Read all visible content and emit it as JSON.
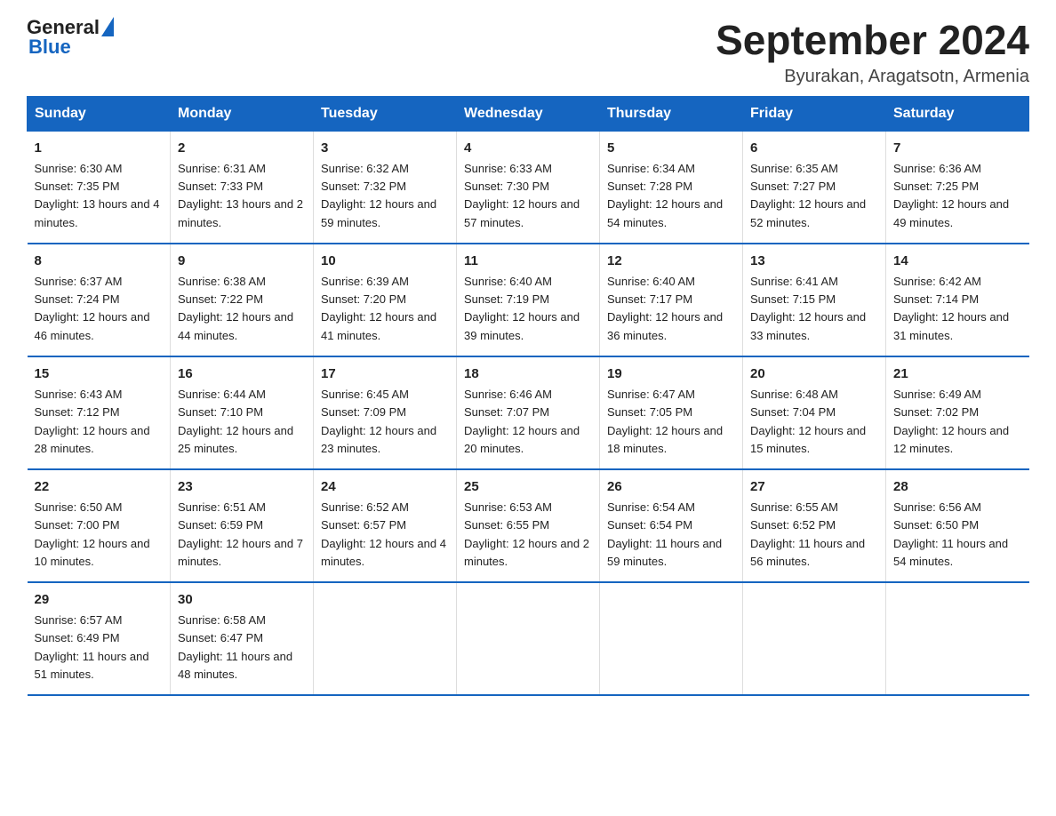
{
  "logo": {
    "text_general": "General",
    "text_blue": "Blue"
  },
  "calendar": {
    "title": "September 2024",
    "subtitle": "Byurakan, Aragatsotn, Armenia"
  },
  "days_of_week": [
    "Sunday",
    "Monday",
    "Tuesday",
    "Wednesday",
    "Thursday",
    "Friday",
    "Saturday"
  ],
  "weeks": [
    [
      {
        "day": "1",
        "sunrise": "Sunrise: 6:30 AM",
        "sunset": "Sunset: 7:35 PM",
        "daylight": "Daylight: 13 hours and 4 minutes."
      },
      {
        "day": "2",
        "sunrise": "Sunrise: 6:31 AM",
        "sunset": "Sunset: 7:33 PM",
        "daylight": "Daylight: 13 hours and 2 minutes."
      },
      {
        "day": "3",
        "sunrise": "Sunrise: 6:32 AM",
        "sunset": "Sunset: 7:32 PM",
        "daylight": "Daylight: 12 hours and 59 minutes."
      },
      {
        "day": "4",
        "sunrise": "Sunrise: 6:33 AM",
        "sunset": "Sunset: 7:30 PM",
        "daylight": "Daylight: 12 hours and 57 minutes."
      },
      {
        "day": "5",
        "sunrise": "Sunrise: 6:34 AM",
        "sunset": "Sunset: 7:28 PM",
        "daylight": "Daylight: 12 hours and 54 minutes."
      },
      {
        "day": "6",
        "sunrise": "Sunrise: 6:35 AM",
        "sunset": "Sunset: 7:27 PM",
        "daylight": "Daylight: 12 hours and 52 minutes."
      },
      {
        "day": "7",
        "sunrise": "Sunrise: 6:36 AM",
        "sunset": "Sunset: 7:25 PM",
        "daylight": "Daylight: 12 hours and 49 minutes."
      }
    ],
    [
      {
        "day": "8",
        "sunrise": "Sunrise: 6:37 AM",
        "sunset": "Sunset: 7:24 PM",
        "daylight": "Daylight: 12 hours and 46 minutes."
      },
      {
        "day": "9",
        "sunrise": "Sunrise: 6:38 AM",
        "sunset": "Sunset: 7:22 PM",
        "daylight": "Daylight: 12 hours and 44 minutes."
      },
      {
        "day": "10",
        "sunrise": "Sunrise: 6:39 AM",
        "sunset": "Sunset: 7:20 PM",
        "daylight": "Daylight: 12 hours and 41 minutes."
      },
      {
        "day": "11",
        "sunrise": "Sunrise: 6:40 AM",
        "sunset": "Sunset: 7:19 PM",
        "daylight": "Daylight: 12 hours and 39 minutes."
      },
      {
        "day": "12",
        "sunrise": "Sunrise: 6:40 AM",
        "sunset": "Sunset: 7:17 PM",
        "daylight": "Daylight: 12 hours and 36 minutes."
      },
      {
        "day": "13",
        "sunrise": "Sunrise: 6:41 AM",
        "sunset": "Sunset: 7:15 PM",
        "daylight": "Daylight: 12 hours and 33 minutes."
      },
      {
        "day": "14",
        "sunrise": "Sunrise: 6:42 AM",
        "sunset": "Sunset: 7:14 PM",
        "daylight": "Daylight: 12 hours and 31 minutes."
      }
    ],
    [
      {
        "day": "15",
        "sunrise": "Sunrise: 6:43 AM",
        "sunset": "Sunset: 7:12 PM",
        "daylight": "Daylight: 12 hours and 28 minutes."
      },
      {
        "day": "16",
        "sunrise": "Sunrise: 6:44 AM",
        "sunset": "Sunset: 7:10 PM",
        "daylight": "Daylight: 12 hours and 25 minutes."
      },
      {
        "day": "17",
        "sunrise": "Sunrise: 6:45 AM",
        "sunset": "Sunset: 7:09 PM",
        "daylight": "Daylight: 12 hours and 23 minutes."
      },
      {
        "day": "18",
        "sunrise": "Sunrise: 6:46 AM",
        "sunset": "Sunset: 7:07 PM",
        "daylight": "Daylight: 12 hours and 20 minutes."
      },
      {
        "day": "19",
        "sunrise": "Sunrise: 6:47 AM",
        "sunset": "Sunset: 7:05 PM",
        "daylight": "Daylight: 12 hours and 18 minutes."
      },
      {
        "day": "20",
        "sunrise": "Sunrise: 6:48 AM",
        "sunset": "Sunset: 7:04 PM",
        "daylight": "Daylight: 12 hours and 15 minutes."
      },
      {
        "day": "21",
        "sunrise": "Sunrise: 6:49 AM",
        "sunset": "Sunset: 7:02 PM",
        "daylight": "Daylight: 12 hours and 12 minutes."
      }
    ],
    [
      {
        "day": "22",
        "sunrise": "Sunrise: 6:50 AM",
        "sunset": "Sunset: 7:00 PM",
        "daylight": "Daylight: 12 hours and 10 minutes."
      },
      {
        "day": "23",
        "sunrise": "Sunrise: 6:51 AM",
        "sunset": "Sunset: 6:59 PM",
        "daylight": "Daylight: 12 hours and 7 minutes."
      },
      {
        "day": "24",
        "sunrise": "Sunrise: 6:52 AM",
        "sunset": "Sunset: 6:57 PM",
        "daylight": "Daylight: 12 hours and 4 minutes."
      },
      {
        "day": "25",
        "sunrise": "Sunrise: 6:53 AM",
        "sunset": "Sunset: 6:55 PM",
        "daylight": "Daylight: 12 hours and 2 minutes."
      },
      {
        "day": "26",
        "sunrise": "Sunrise: 6:54 AM",
        "sunset": "Sunset: 6:54 PM",
        "daylight": "Daylight: 11 hours and 59 minutes."
      },
      {
        "day": "27",
        "sunrise": "Sunrise: 6:55 AM",
        "sunset": "Sunset: 6:52 PM",
        "daylight": "Daylight: 11 hours and 56 minutes."
      },
      {
        "day": "28",
        "sunrise": "Sunrise: 6:56 AM",
        "sunset": "Sunset: 6:50 PM",
        "daylight": "Daylight: 11 hours and 54 minutes."
      }
    ],
    [
      {
        "day": "29",
        "sunrise": "Sunrise: 6:57 AM",
        "sunset": "Sunset: 6:49 PM",
        "daylight": "Daylight: 11 hours and 51 minutes."
      },
      {
        "day": "30",
        "sunrise": "Sunrise: 6:58 AM",
        "sunset": "Sunset: 6:47 PM",
        "daylight": "Daylight: 11 hours and 48 minutes."
      },
      {
        "day": "",
        "sunrise": "",
        "sunset": "",
        "daylight": ""
      },
      {
        "day": "",
        "sunrise": "",
        "sunset": "",
        "daylight": ""
      },
      {
        "day": "",
        "sunrise": "",
        "sunset": "",
        "daylight": ""
      },
      {
        "day": "",
        "sunrise": "",
        "sunset": "",
        "daylight": ""
      },
      {
        "day": "",
        "sunrise": "",
        "sunset": "",
        "daylight": ""
      }
    ]
  ]
}
